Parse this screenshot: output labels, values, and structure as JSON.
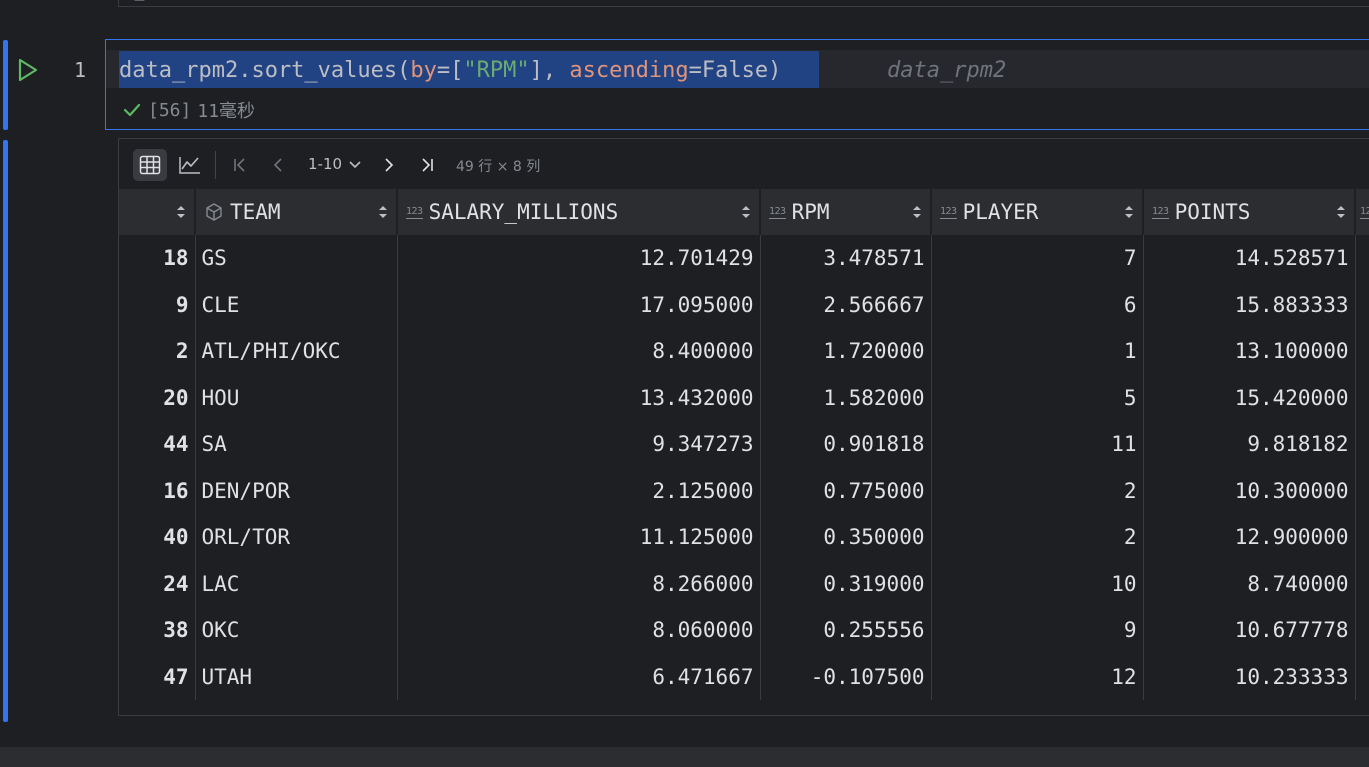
{
  "prev_cell": {
    "glyph": "ᅳ"
  },
  "code_cell": {
    "line_number": "1",
    "code_tokens": {
      "prefix": "data_rpm2.sort_values(",
      "by_kw": "by",
      "by_eq": "=[",
      "by_val": "\"RPM\"",
      "mid": "], ",
      "asc_kw": "ascending",
      "asc_eq": "=False)"
    },
    "inline_hint": "data_rpm2",
    "exec_count": "[56]",
    "exec_time": "11毫秒"
  },
  "toolbar": {
    "page_range": "1-10",
    "shape_info": "49 行 × 8 列"
  },
  "table": {
    "columns": [
      {
        "label": "",
        "type": ""
      },
      {
        "label": "TEAM",
        "type": "object"
      },
      {
        "label": "SALARY_MILLIONS",
        "type": "123"
      },
      {
        "label": "RPM",
        "type": "123"
      },
      {
        "label": "PLAYER",
        "type": "123"
      },
      {
        "label": "POINTS",
        "type": "123"
      },
      {
        "label": "",
        "type": "123"
      }
    ],
    "rows": [
      {
        "idx": "18",
        "team": "GS",
        "salary": "12.701429",
        "rpm": "3.478571",
        "player": "7",
        "points": "14.528571"
      },
      {
        "idx": "9",
        "team": "CLE",
        "salary": "17.095000",
        "rpm": "2.566667",
        "player": "6",
        "points": "15.883333"
      },
      {
        "idx": "2",
        "team": "ATL/PHI/OKC",
        "salary": "8.400000",
        "rpm": "1.720000",
        "player": "1",
        "points": "13.100000"
      },
      {
        "idx": "20",
        "team": "HOU",
        "salary": "13.432000",
        "rpm": "1.582000",
        "player": "5",
        "points": "15.420000"
      },
      {
        "idx": "44",
        "team": "SA",
        "salary": "9.347273",
        "rpm": "0.901818",
        "player": "11",
        "points": "9.818182"
      },
      {
        "idx": "16",
        "team": "DEN/POR",
        "salary": "2.125000",
        "rpm": "0.775000",
        "player": "2",
        "points": "10.300000"
      },
      {
        "idx": "40",
        "team": "ORL/TOR",
        "salary": "11.125000",
        "rpm": "0.350000",
        "player": "2",
        "points": "12.900000"
      },
      {
        "idx": "24",
        "team": "LAC",
        "salary": "8.266000",
        "rpm": "0.319000",
        "player": "10",
        "points": "8.740000"
      },
      {
        "idx": "38",
        "team": "OKC",
        "salary": "8.060000",
        "rpm": "0.255556",
        "player": "9",
        "points": "10.677778"
      },
      {
        "idx": "47",
        "team": "UTAH",
        "salary": "6.471667",
        "rpm": "-0.107500",
        "player": "12",
        "points": "10.233333"
      }
    ]
  },
  "colors": {
    "accent": "#3574f0",
    "selection": "#214283",
    "param": "#e0957b",
    "string": "#6aab73",
    "success": "#5fb865"
  },
  "icons": {
    "run": "play-icon",
    "status": "check-icon",
    "table_view": "table-icon",
    "chart_view": "line-chart-icon",
    "first": "first-page-icon",
    "prev": "chevron-left-icon",
    "dropdown": "chevron-down-icon",
    "next": "chevron-right-icon",
    "last": "last-page-icon",
    "sort": "sort-icon",
    "type_object": "cube-icon"
  }
}
